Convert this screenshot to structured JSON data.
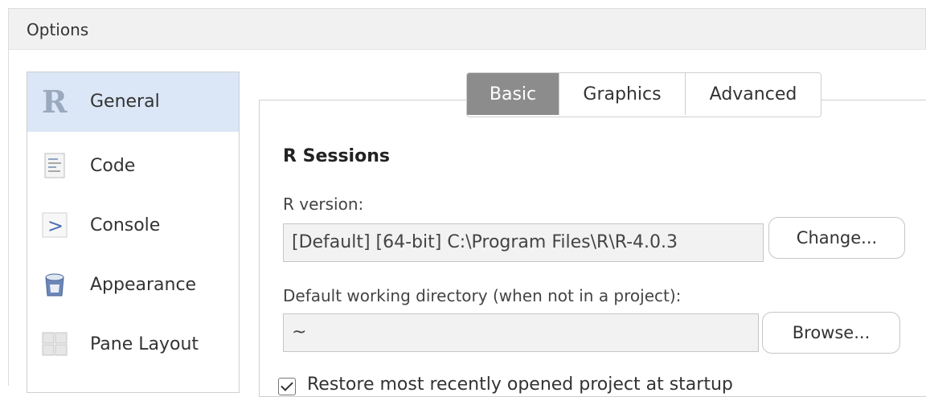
{
  "window": {
    "title": "Options"
  },
  "sidebar": {
    "items": [
      {
        "label": "General",
        "icon": "r-logo-icon",
        "selected": true
      },
      {
        "label": "Code",
        "icon": "code-document-icon",
        "selected": false
      },
      {
        "label": "Console",
        "icon": "console-prompt-icon",
        "selected": false
      },
      {
        "label": "Appearance",
        "icon": "paint-bucket-icon",
        "selected": false
      },
      {
        "label": "Pane Layout",
        "icon": "pane-layout-icon",
        "selected": false
      }
    ]
  },
  "tabs": [
    {
      "label": "Basic",
      "active": true
    },
    {
      "label": "Graphics",
      "active": false
    },
    {
      "label": "Advanced",
      "active": false
    }
  ],
  "r_sessions": {
    "title": "R Sessions",
    "r_version_label": "R version:",
    "r_version_value": "[Default] [64-bit] C:\\Program Files\\R\\R-4.0.3",
    "change_button": "Change...",
    "working_dir_label": "Default working directory (when not in a project):",
    "working_dir_value": "~",
    "browse_button": "Browse...",
    "restore_project_label": "Restore most recently opened project at startup",
    "restore_project_checked": true
  },
  "colors": {
    "selected_sidebar": "#dbe7f6",
    "active_tab": "#8c8c8c",
    "titlebar": "#f1f1f1"
  }
}
